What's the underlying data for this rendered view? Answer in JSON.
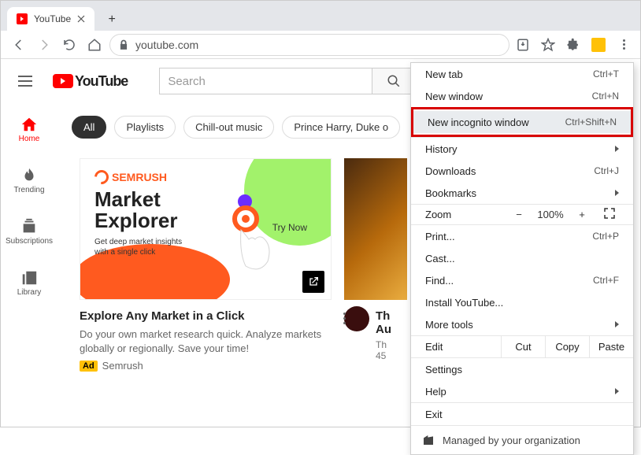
{
  "window": {
    "tab_title": "YouTube",
    "url": "youtube.com"
  },
  "yt": {
    "brand": "YouTube",
    "search_placeholder": "Search",
    "sidebar": {
      "home": "Home",
      "trending": "Trending",
      "subscriptions": "Subscriptions",
      "library": "Library"
    },
    "chips": {
      "all": "All",
      "playlists": "Playlists",
      "chillout": "Chill-out music",
      "prince": "Prince Harry, Duke o"
    },
    "ad": {
      "brand": "SEMRUSH",
      "headline1": "Market",
      "headline2": "Explorer",
      "sub": "Get deep market insights\nwith a single click",
      "trynow": "Try Now",
      "title": "Explore Any Market in a Click",
      "desc": "Do your own market research quick. Analyze markets globally or regionally. Save your time!",
      "badge": "Ad",
      "sponsor": "Semrush"
    },
    "video2": {
      "title_line1": "Th",
      "title_line2": "Au",
      "meta1": "Th",
      "meta2": "45"
    }
  },
  "menu": {
    "new_tab": "New tab",
    "sc_new_tab": "Ctrl+T",
    "new_window": "New window",
    "sc_new_window": "Ctrl+N",
    "new_incognito": "New incognito window",
    "sc_new_incognito": "Ctrl+Shift+N",
    "history": "History",
    "downloads": "Downloads",
    "sc_downloads": "Ctrl+J",
    "bookmarks": "Bookmarks",
    "zoom": "Zoom",
    "zoom_value": "100%",
    "print": "Print...",
    "sc_print": "Ctrl+P",
    "cast": "Cast...",
    "find": "Find...",
    "sc_find": "Ctrl+F",
    "install": "Install YouTube...",
    "more_tools": "More tools",
    "edit": "Edit",
    "cut": "Cut",
    "copy": "Copy",
    "paste": "Paste",
    "settings": "Settings",
    "help": "Help",
    "exit": "Exit",
    "managed": "Managed by your organization"
  }
}
